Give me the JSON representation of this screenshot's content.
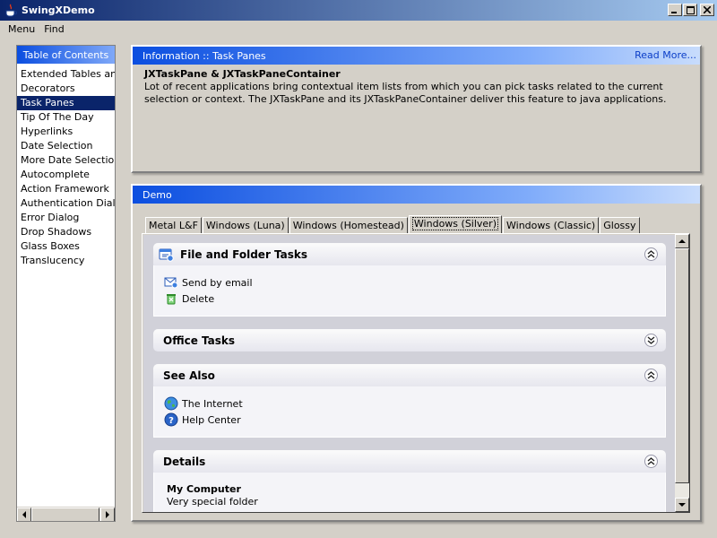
{
  "window": {
    "title": "SwingXDemo"
  },
  "menubar": {
    "items": [
      "Menu",
      "Find"
    ]
  },
  "toc": {
    "header": "Table of Contents",
    "items": [
      "Extended Tables and",
      "Decorators",
      "Task Panes",
      "Tip Of The Day",
      "Hyperlinks",
      "Date Selection",
      "More Date Selection",
      "Autocomplete",
      "Action Framework",
      "Authentication Dialogs",
      "Error Dialog",
      "Drop Shadows",
      "Glass Boxes",
      "Translucency"
    ],
    "selected_index": 2
  },
  "info": {
    "header": "Information :: Task Panes",
    "read_more": "Read More...",
    "heading": "JXTaskPane & JXTaskPaneContainer",
    "text": "Lot of recent applications bring contextual item lists from which you can pick tasks related to the current selection or context. The JXTaskPane and its JXTaskPaneContainer deliver this feature to java applications."
  },
  "demo": {
    "header": "Demo",
    "tabs": [
      "Metal L&F",
      "Windows (Luna)",
      "Windows (Homestead)",
      "Windows (Silver)",
      "Windows (Classic)",
      "Glossy"
    ],
    "active_tab": 3,
    "groups": {
      "file_folder": {
        "title": "File and Folder Tasks",
        "icon": "folder-tasks-icon",
        "expanded": true,
        "tasks": [
          {
            "label": "Send by email",
            "icon": "email-icon"
          },
          {
            "label": "Delete",
            "icon": "delete-icon"
          }
        ]
      },
      "office": {
        "title": "Office Tasks",
        "expanded": false
      },
      "see_also": {
        "title": "See Also",
        "expanded": true,
        "tasks": [
          {
            "label": "The Internet",
            "icon": "globe-icon"
          },
          {
            "label": "Help Center",
            "icon": "help-icon"
          }
        ]
      },
      "details": {
        "title": "Details",
        "expanded": true,
        "name": "My Computer",
        "desc": "Very special folder"
      }
    }
  },
  "colors": {
    "titlebar_start": "#0a246a",
    "panel_header": "#0b4ee0",
    "selection": "#0a246a",
    "link": "#0b3ec8",
    "taskpane_bg": "#d1d1d9"
  }
}
